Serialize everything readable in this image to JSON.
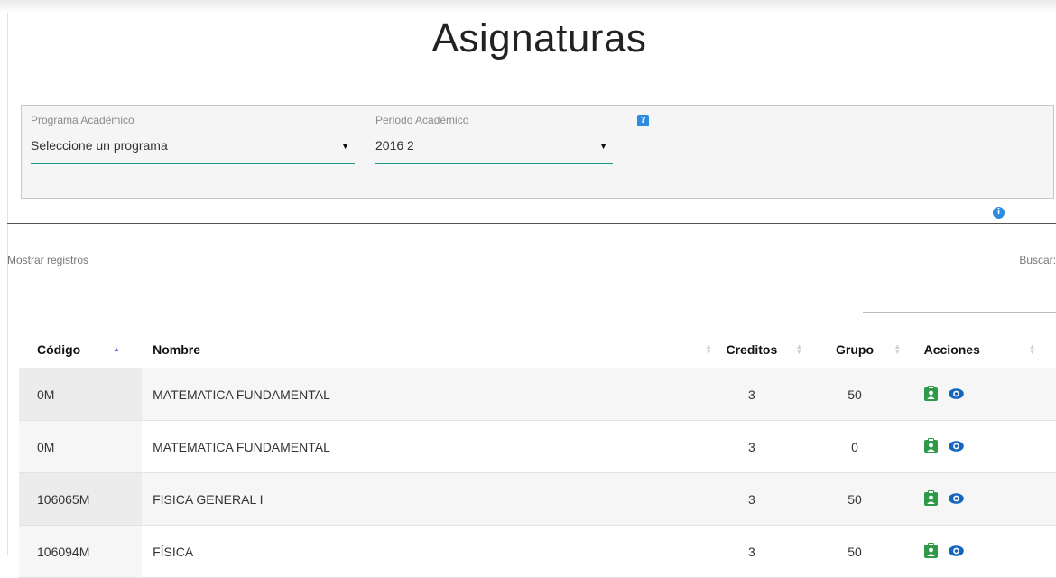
{
  "page": {
    "title": "Asignaturas"
  },
  "filters": {
    "programa": {
      "label": "Programa Académico",
      "value": "Seleccione un programa"
    },
    "periodo": {
      "label": "Periodo Académico",
      "value": "2016 2"
    },
    "help_icon": "question-icon"
  },
  "table_controls": {
    "show_records_label": "Mostrar registros",
    "search_label": "Buscar:",
    "search_value": "",
    "info_icon": "info-icon"
  },
  "table": {
    "columns": [
      "Código",
      "Nombre",
      "Creditos",
      "Grupo",
      "Acciones"
    ],
    "sorted_column": "Código",
    "rows": [
      {
        "codigo": "0M",
        "nombre": "MATEMATICA FUNDAMENTAL",
        "creditos": "3",
        "grupo": "50"
      },
      {
        "codigo": "0M",
        "nombre": "MATEMATICA FUNDAMENTAL",
        "creditos": "3",
        "grupo": "0"
      },
      {
        "codigo": "106065M",
        "nombre": "FISICA GENERAL I",
        "creditos": "3",
        "grupo": "50"
      },
      {
        "codigo": "106094M",
        "nombre": "FÍSICA",
        "creditos": "3",
        "grupo": "50"
      }
    ],
    "row_actions": [
      "clipboard-user-icon",
      "eye-icon"
    ]
  },
  "colors": {
    "accent": "#1a9a8a",
    "info_blue": "#2d8be0",
    "action_green": "#2e9a47",
    "action_blue": "#1565c0"
  }
}
